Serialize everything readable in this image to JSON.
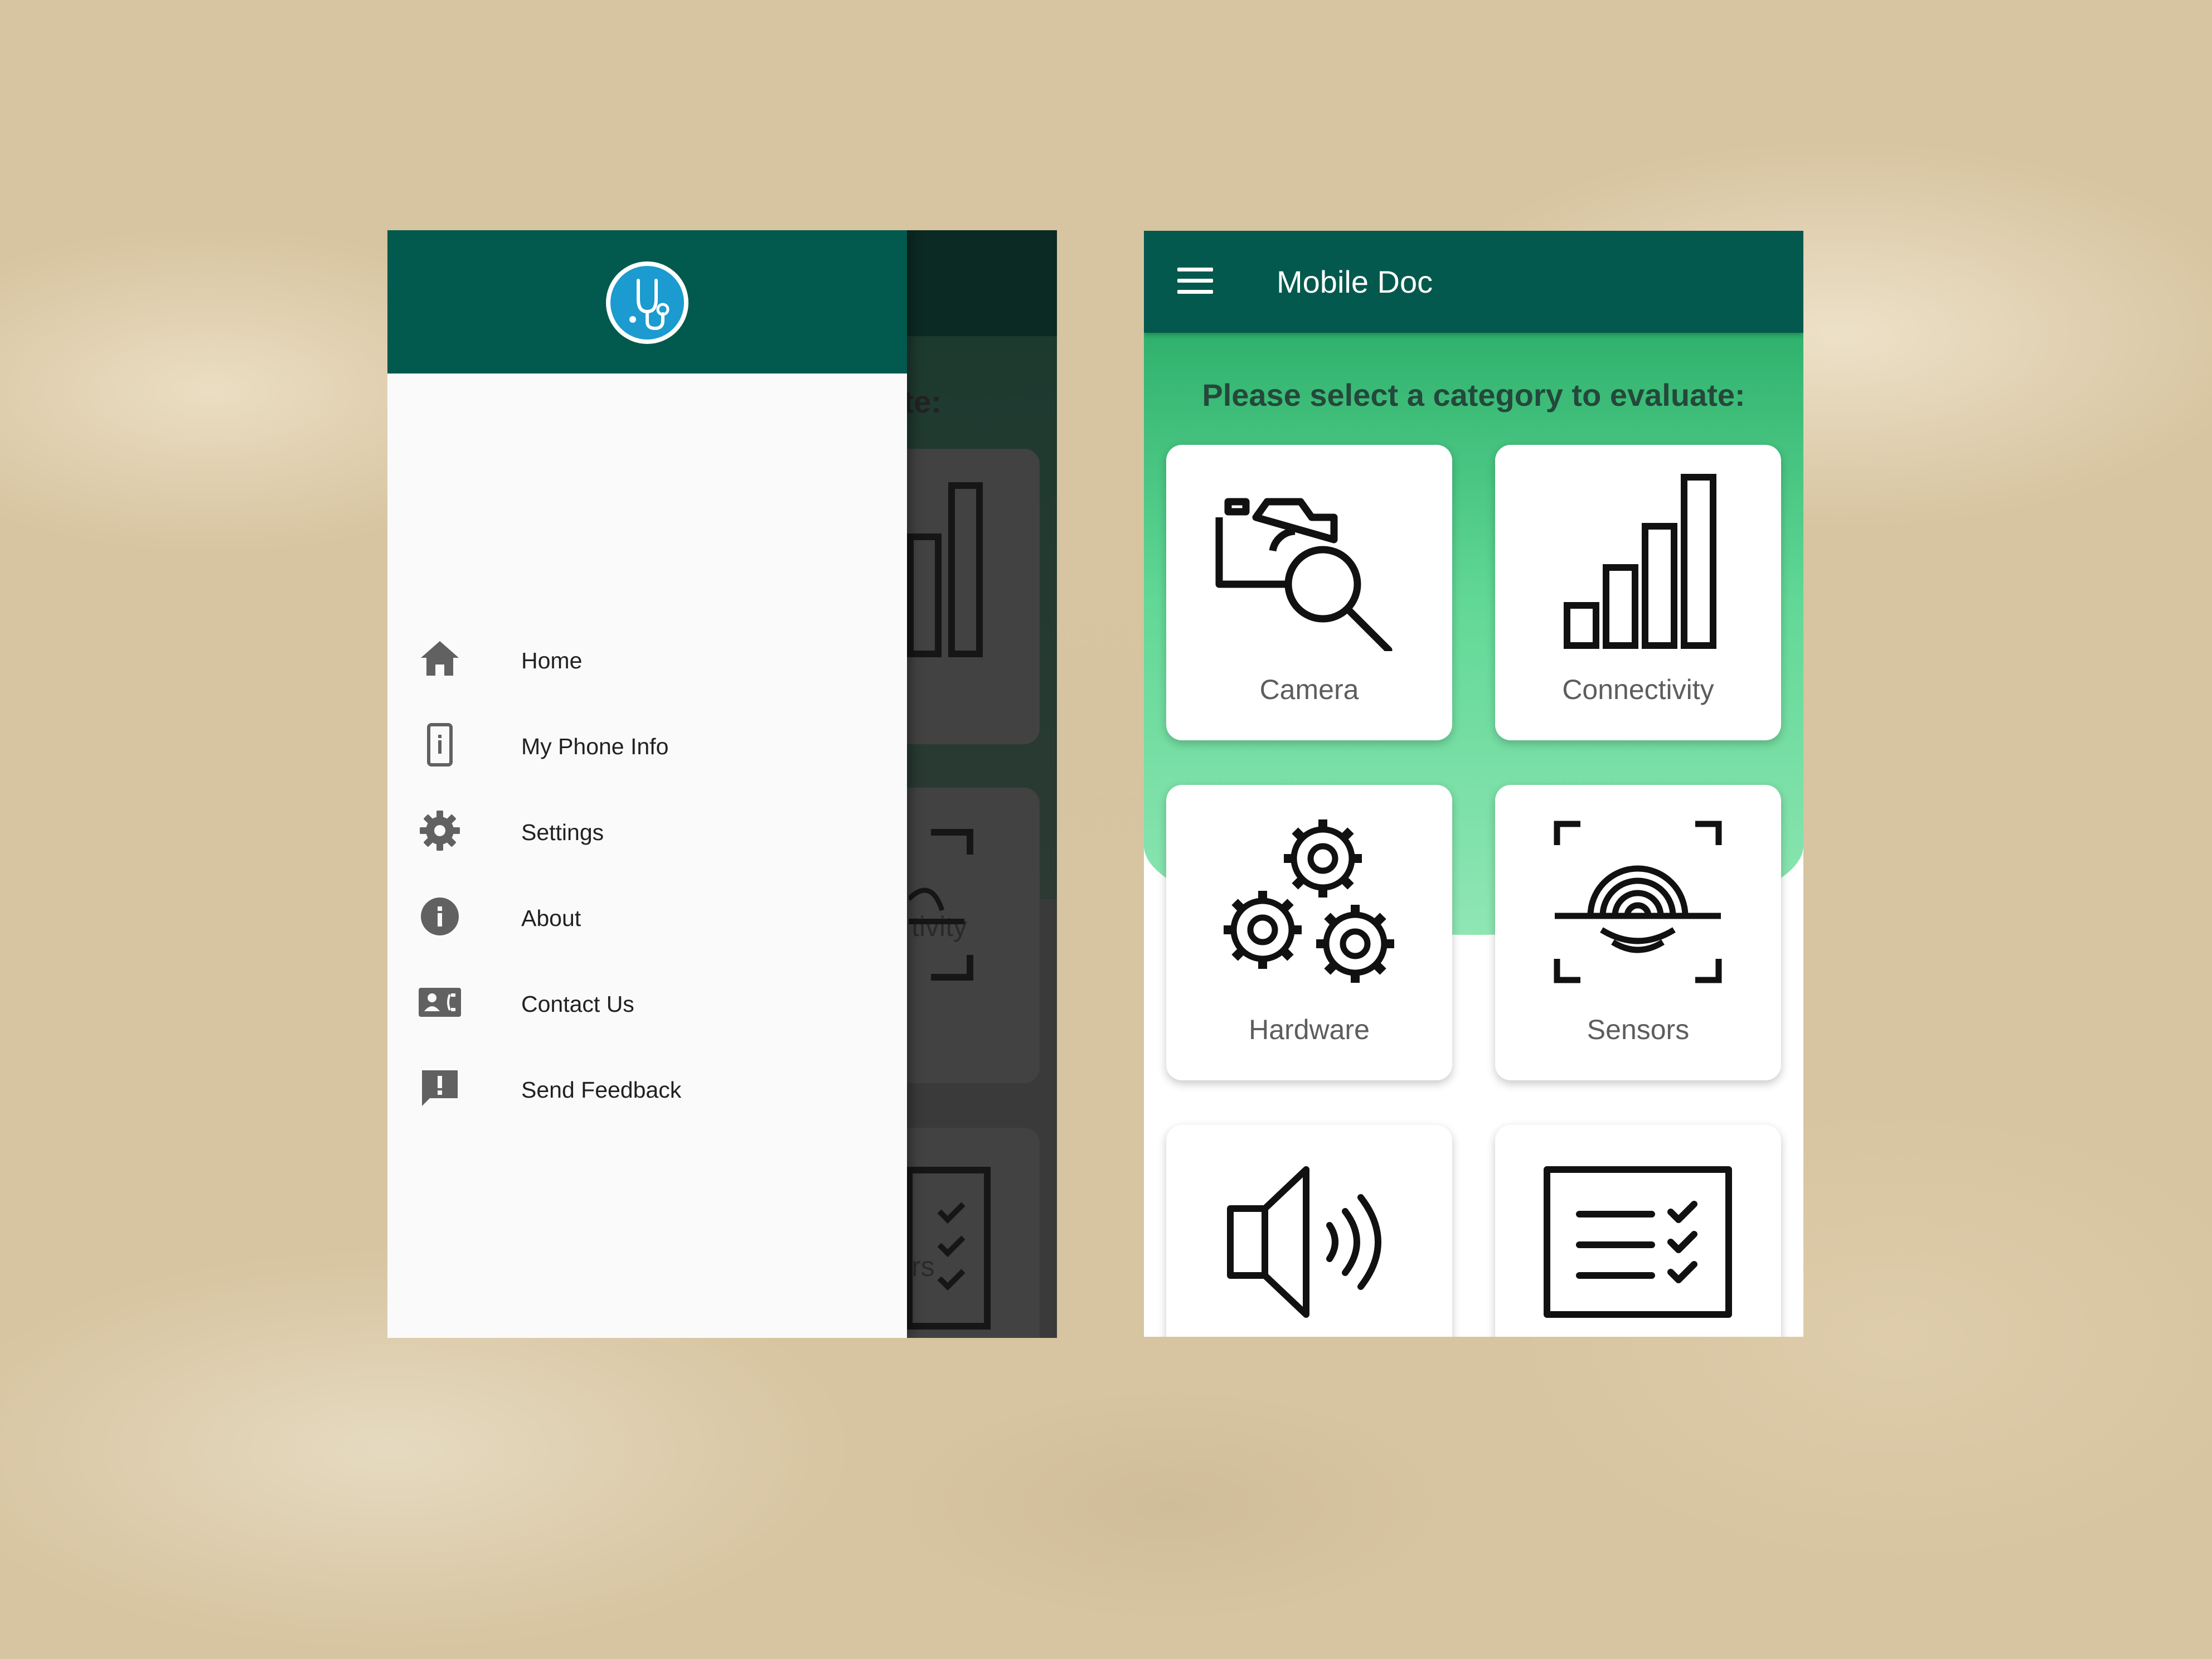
{
  "drawer": {
    "logo_icon": "stethoscope-icon",
    "items": [
      {
        "label": "Home",
        "icon": "home-icon"
      },
      {
        "label": "My Phone Info",
        "icon": "phone-info-icon"
      },
      {
        "label": "Settings",
        "icon": "gear-icon"
      },
      {
        "label": "About",
        "icon": "info-icon"
      },
      {
        "label": "Contact Us",
        "icon": "contact-card-icon"
      },
      {
        "label": "Send Feedback",
        "icon": "feedback-icon"
      }
    ]
  },
  "background_screen": {
    "partial_title": "uate:",
    "partial_labels": [
      "tivity",
      "rs"
    ]
  },
  "home": {
    "app_title": "Mobile Doc",
    "menu_icon": "hamburger-menu-icon",
    "subtitle": "Please select a category to evaluate:",
    "categories": [
      {
        "label": "Camera",
        "icon": "camera-search-icon"
      },
      {
        "label": "Connectivity",
        "icon": "signal-bars-icon"
      },
      {
        "label": "Hardware",
        "icon": "gears-icon"
      },
      {
        "label": "Sensors",
        "icon": "fingerprint-scan-icon"
      },
      {
        "label": "",
        "icon": "speaker-icon"
      },
      {
        "label": "",
        "icon": "checklist-icon"
      }
    ]
  },
  "colors": {
    "primary": "#03594d",
    "accent_green": "#62d896",
    "logo_blue": "#1b9bcf",
    "drawer_bg": "#fafafa"
  }
}
